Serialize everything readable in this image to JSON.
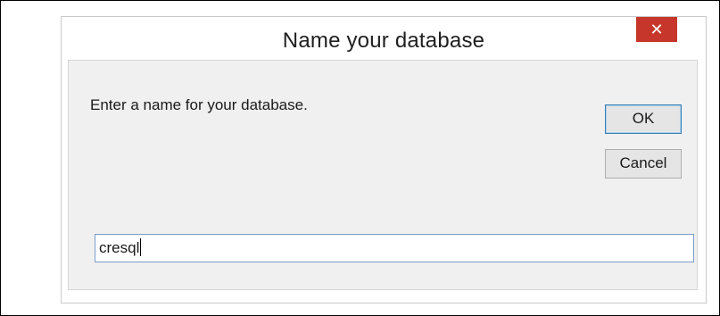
{
  "dialog": {
    "title": "Name your database",
    "close_glyph": "✕",
    "close_icon": "close-icon",
    "prompt": "Enter a name for your database.",
    "ok_label": "OK",
    "cancel_label": "Cancel",
    "input_value": "cresql"
  },
  "colors": {
    "close_button": "#c7362a",
    "client_background": "#f0f0f0",
    "focus_border": "#3c7fb1"
  }
}
